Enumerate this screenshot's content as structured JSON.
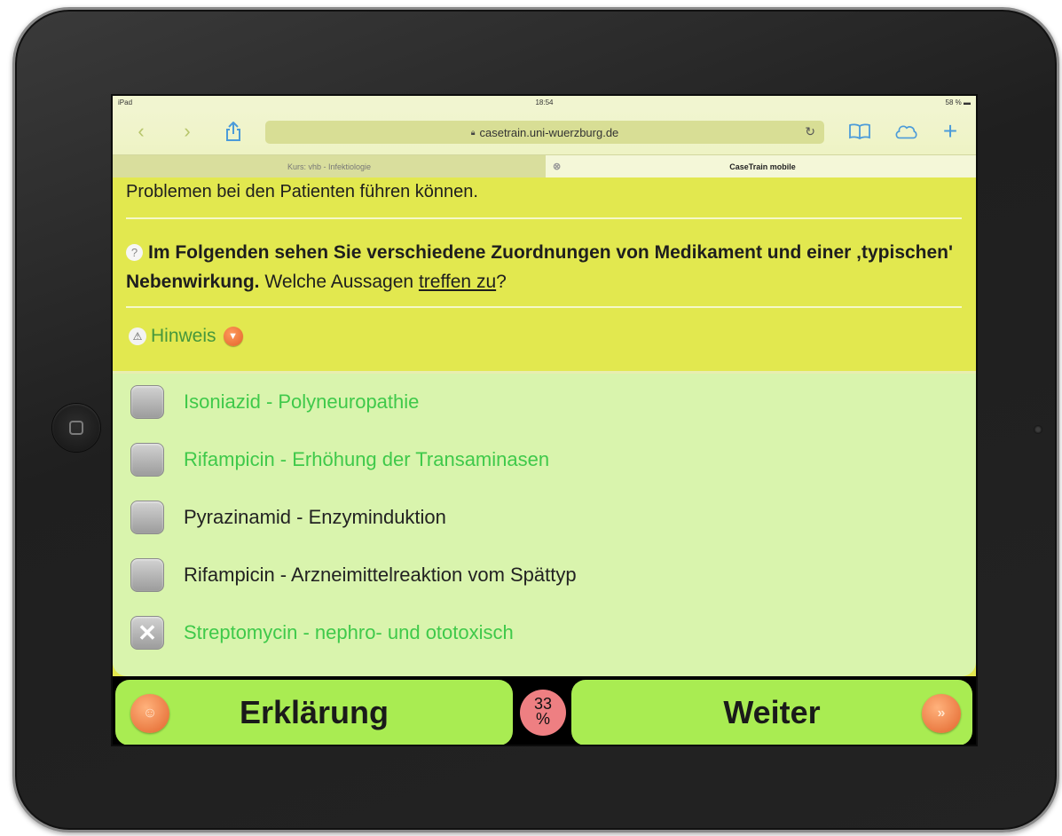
{
  "status_bar": {
    "device": "iPad",
    "time": "18:54",
    "battery": "58 %"
  },
  "browser": {
    "url": "casetrain.uni-wuerzburg.de",
    "tabs": [
      {
        "label": "Kurs: vhb - Infektiologie"
      },
      {
        "label": "CaseTrain mobile"
      }
    ]
  },
  "question": {
    "intro": "Problemen bei den Patienten führen können.",
    "bold": "Im Folgenden sehen Sie verschiedene Zuordnungen von Medikament und einer ‚typischen' Nebenwirkung.",
    "normal": "Welche Aussagen",
    "underlined": "treffen zu",
    "end": "?",
    "hint_label": "Hinweis"
  },
  "answers": [
    {
      "label": "Isoniazid - Polyneuropathie",
      "color": "#3fc94a",
      "checked": false
    },
    {
      "label": "Rifampicin - Erhöhung der Transaminasen",
      "color": "#3fc94a",
      "checked": false
    },
    {
      "label": "Pyrazinamid - Enzyminduktion",
      "color": "#222222",
      "checked": false
    },
    {
      "label": "Rifampicin - Arzneimittelreaktion vom Spättyp",
      "color": "#222222",
      "checked": false
    },
    {
      "label": "Streptomycin - nephro- und ototoxisch",
      "color": "#3fc94a",
      "checked": true
    }
  ],
  "bottom": {
    "explain_label": "Erklärung",
    "next_label": "Weiter",
    "progress_value": "33",
    "progress_unit": "%"
  },
  "colors": {
    "question_bg": "#e2e84f",
    "answers_bg": "#d9f4ad",
    "button_bg": "#a9ec52",
    "progress_bg": "#ee7f82"
  }
}
